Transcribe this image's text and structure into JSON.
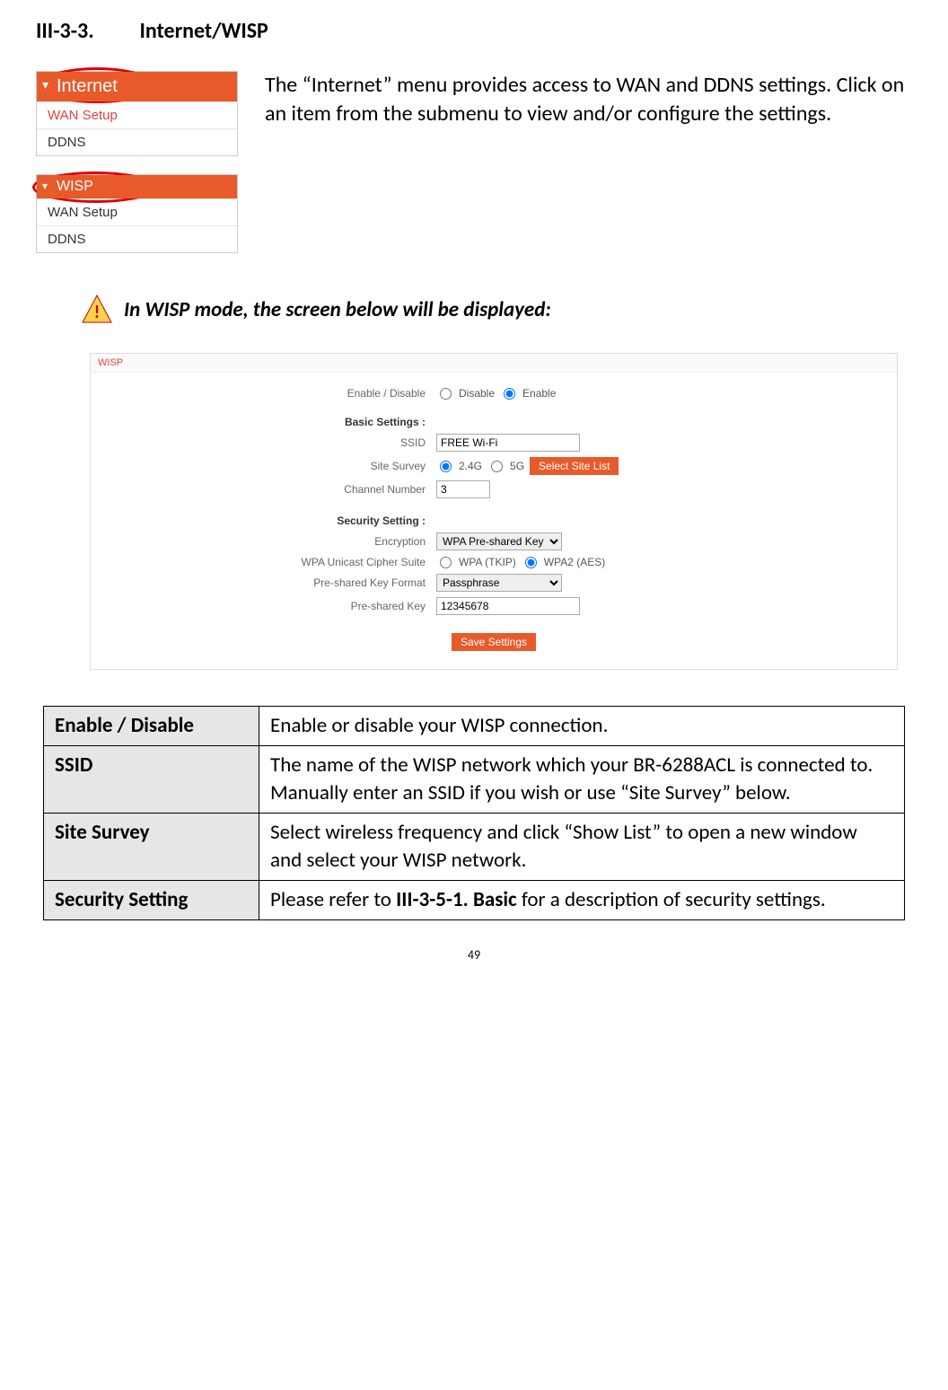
{
  "heading": {
    "num": "III-3-3.",
    "title": "Internet/WISP"
  },
  "intro": "The “Internet” menu provides access to WAN and DDNS settings. Click on an item from the submenu to view and/or configure the settings.",
  "menu1": {
    "header": "Internet",
    "items": [
      "WAN Setup",
      "DDNS"
    ]
  },
  "menu2": {
    "header": "WISP",
    "items": [
      "WAN Setup",
      "DDNS"
    ]
  },
  "warn": "In WISP mode, the screen below will be displayed:",
  "wisp": {
    "title": "WISP",
    "enable_label": "Enable / Disable",
    "disable": "Disable",
    "enable": "Enable",
    "basic_header": "Basic Settings  :",
    "ssid_label": "SSID",
    "ssid_value": "FREE Wi-Fi",
    "survey_label": "Site Survey",
    "band24": "2.4G",
    "band5": "5G",
    "select_list": "Select Site List",
    "channel_label": "Channel Number",
    "channel_value": "3",
    "sec_header": "Security Setting  :",
    "enc_label": "Encryption",
    "enc_value": "WPA Pre-shared Key",
    "cipher_label": "WPA Unicast Cipher Suite",
    "cipher_tkip": "WPA (TKIP)",
    "cipher_aes": "WPA2 (AES)",
    "pskfmt_label": "Pre-shared Key Format",
    "pskfmt_value": "Passphrase",
    "psk_label": "Pre-shared Key",
    "psk_value": "12345678",
    "save": "Save Settings"
  },
  "table": {
    "r1k": "Enable / Disable",
    "r1v": "Enable or disable your WISP connection.",
    "r2k": "SSID",
    "r2v": "The name of the WISP network which your BR-6288ACL is connected to. Manually enter an SSID if you wish or use “Site Survey” below.",
    "r3k": "Site Survey",
    "r3v": "Select wireless frequency and click “Show List” to open a new window and select your WISP network.",
    "r4k": "Security Setting",
    "r4v_a": "Please refer to ",
    "r4v_b": "III-3-5-1. Basic",
    "r4v_c": " for a description of security settings."
  },
  "page": "49"
}
